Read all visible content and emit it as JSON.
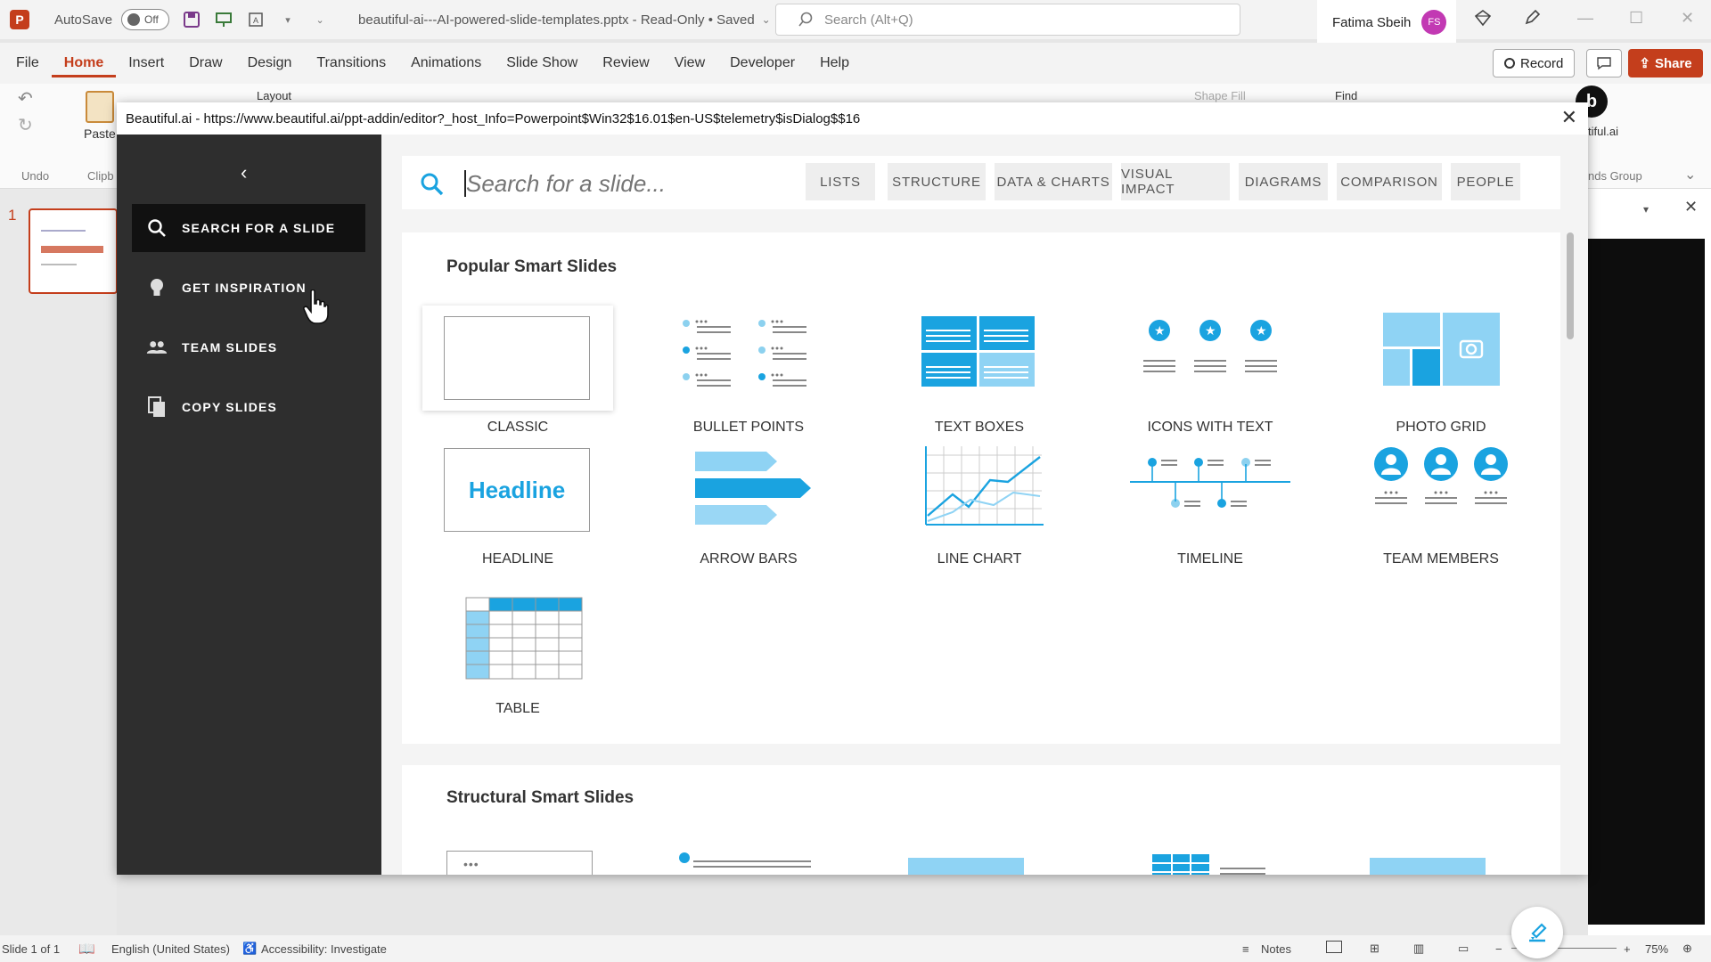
{
  "titlebar": {
    "app_icon": "P",
    "autosave_label": "AutoSave",
    "autosave_state": "Off",
    "doc_title": "beautiful-ai---AI-powered-slide-templates.pptx  -  Read-Only • Saved",
    "search_placeholder": "Search (Alt+Q)",
    "user_name": "Fatima Sbeih",
    "user_initials": "FS"
  },
  "menu": {
    "items": [
      "File",
      "Home",
      "Insert",
      "Draw",
      "Design",
      "Transitions",
      "Animations",
      "Slide Show",
      "Review",
      "View",
      "Developer",
      "Help"
    ],
    "active": "Home",
    "record_label": "Record",
    "share_label": "Share"
  },
  "ribbon": {
    "undo_label": "Undo",
    "paste_label": "Paste",
    "clipboard_label": "Clipb",
    "layout_label": "Layout",
    "shape_fill_label": "Shape Fill",
    "find_label": "Find",
    "addin_label": "tiful.ai",
    "group_label": "nds Group"
  },
  "slides": {
    "number": "1"
  },
  "statusbar": {
    "slide_info": "Slide 1 of 1",
    "language": "English (United States)",
    "accessibility": "Accessibility: Investigate",
    "notes": "Notes",
    "zoom": "75%"
  },
  "dialog": {
    "title": "Beautiful.ai - https://www.beautiful.ai/ppt-addin/editor?_host_Info=Powerpoint$Win32$16.01$en-US$telemetry$isDialog$$16",
    "sidebar": [
      {
        "label": "SEARCH FOR A SLIDE",
        "icon": "search-icon"
      },
      {
        "label": "GET INSPIRATION",
        "icon": "lightbulb-icon"
      },
      {
        "label": "TEAM SLIDES",
        "icon": "team-icon"
      },
      {
        "label": "COPY SLIDES",
        "icon": "copy-icon"
      }
    ],
    "search_placeholder": "Search for a slide...",
    "filters": [
      "LISTS",
      "STRUCTURE",
      "DATA & CHARTS",
      "VISUAL IMPACT",
      "DIAGRAMS",
      "COMPARISON",
      "PEOPLE"
    ],
    "popular_title": "Popular Smart Slides",
    "popular": [
      "CLASSIC",
      "BULLET POINTS",
      "TEXT BOXES",
      "ICONS WITH TEXT",
      "PHOTO GRID",
      "HEADLINE",
      "ARROW BARS",
      "LINE CHART",
      "TIMELINE",
      "TEAM MEMBERS",
      "TABLE"
    ],
    "headline_thumb_text": "Headline",
    "structural_title": "Structural Smart Slides"
  },
  "colors": {
    "accent": "#c43e1c",
    "ba_blue": "#1aa3e0",
    "ba_light_blue": "#8fd3f4",
    "sidebar_dark": "#2e2e2e"
  }
}
